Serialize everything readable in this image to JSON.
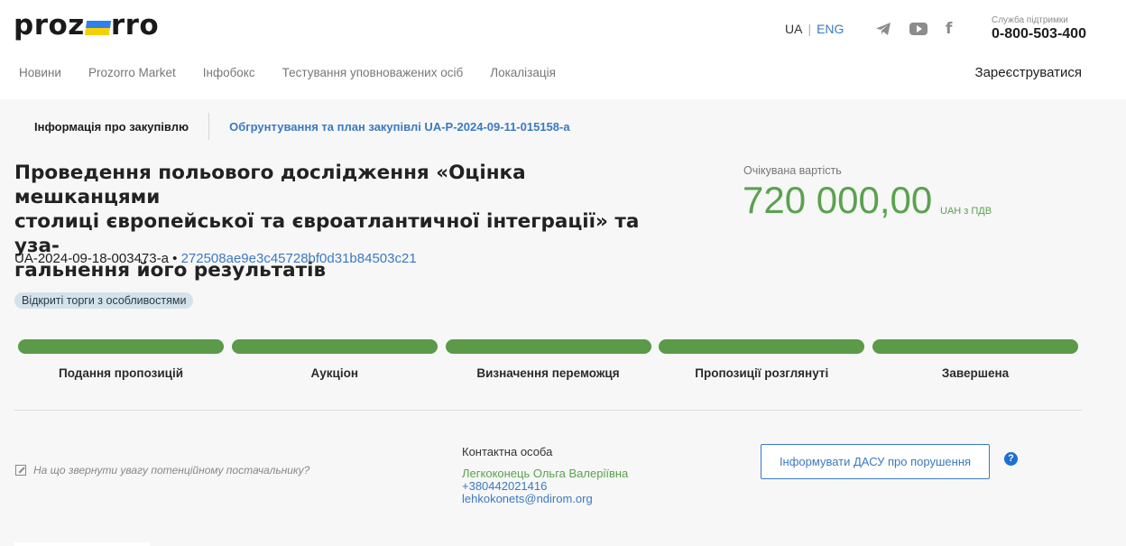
{
  "header": {
    "logo_left": "proz",
    "logo_right": "rro",
    "lang_active": "UA",
    "lang_sep": "|",
    "lang_link": "ENG",
    "support_label": "Служба підтримки",
    "support_phone": "0-800-503-400",
    "icons": [
      "telegram-icon",
      "youtube-icon",
      "facebook-icon"
    ],
    "facebook_glyph": "f"
  },
  "nav": {
    "items": [
      "Новини",
      "Prozorro Market",
      "Інфобокс",
      "Тестування уповноважених осіб",
      "Локалізація"
    ],
    "register": "Зареєструватися"
  },
  "subnav": {
    "active": "Інформація про закупівлю",
    "link": "Обгрунтування та план закупівлі UA-P-2024-09-11-015158-a"
  },
  "tender": {
    "title_lines": [
      "Проведення польового дослідження «Оцінка мешканцями",
      "столиці європейської та євроатлантичної інтеграції» та уза-",
      "гальнення його результатів"
    ],
    "id": "UA-2024-09-18-003473-a",
    "id_sep": "•",
    "hash": "272508ae9e3c45728bf0d31b84503c21",
    "procedure": "Відкриті торги з особливостями",
    "expected_label": "Очікувана вартість",
    "amount": "720 000,00",
    "currency": "UAH з ПДВ"
  },
  "stages": [
    "Подання пропозицій",
    "Аукціон",
    "Визначення переможця",
    "Пропозиції розглянуті",
    "Завершена"
  ],
  "footer": {
    "hint": "На що звернути увагу потенційному постачальнику?",
    "contact_label": "Контактна особа",
    "contact_name": "Легкоконець Ольга Валеріївна",
    "contact_phone": "+380442021416",
    "contact_email": "lehkokonets@ndirom.org",
    "dasu_button": "Інформувати ДАСУ про порушення",
    "help_glyph": "?"
  },
  "colors": {
    "accent_blue": "#3b79c1",
    "success_green": "#5aa24e",
    "bar_green": "#5b9a48"
  }
}
